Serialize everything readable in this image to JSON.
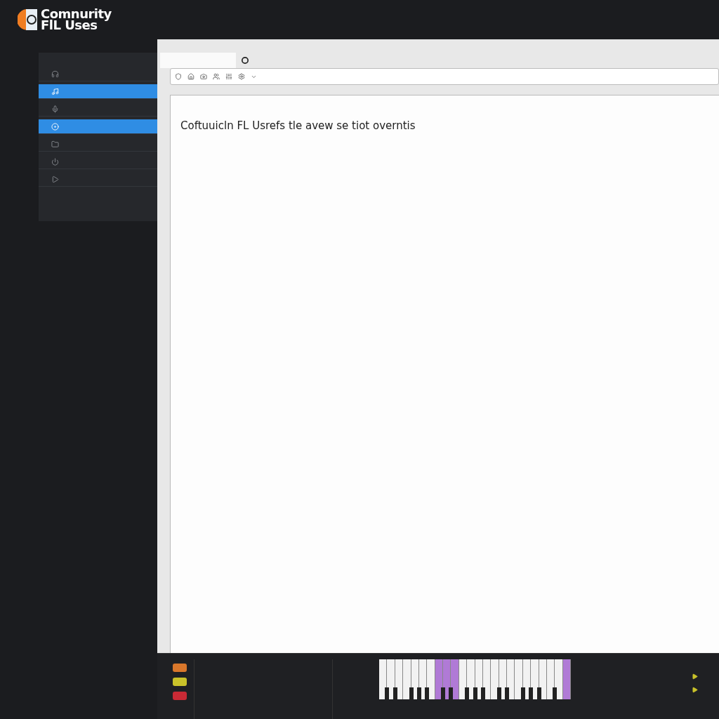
{
  "logo": {
    "lines": [
      "Comnurity",
      "FlL Uses"
    ]
  },
  "sidebar": {
    "items": [
      {
        "selected": false
      },
      {
        "selected": true
      },
      {
        "selected": false
      },
      {
        "selected": true
      },
      {
        "selected": false
      },
      {
        "selected": false
      },
      {
        "selected": false
      }
    ]
  },
  "document": {
    "heading": "Coftuuicln FL Usrefs tle avew se tiot overntis"
  },
  "mixer": {
    "badges": [
      {
        "color": "#d9772b"
      },
      {
        "color": "#c9c22a"
      },
      {
        "color": "#c92a35"
      }
    ],
    "keys": [
      {
        "highlighted": false
      },
      {
        "highlighted": false
      },
      {
        "highlighted": false
      },
      {
        "highlighted": false
      },
      {
        "highlighted": false
      },
      {
        "highlighted": false
      },
      {
        "highlighted": false
      },
      {
        "highlighted": true
      },
      {
        "highlighted": true
      },
      {
        "highlighted": true
      },
      {
        "highlighted": false
      },
      {
        "highlighted": false
      },
      {
        "highlighted": false
      },
      {
        "highlighted": false
      },
      {
        "highlighted": false
      },
      {
        "highlighted": false
      },
      {
        "highlighted": false
      },
      {
        "highlighted": false
      },
      {
        "highlighted": false
      },
      {
        "highlighted": false
      },
      {
        "highlighted": false
      },
      {
        "highlighted": false
      },
      {
        "highlighted": false
      },
      {
        "highlighted": true
      }
    ]
  }
}
